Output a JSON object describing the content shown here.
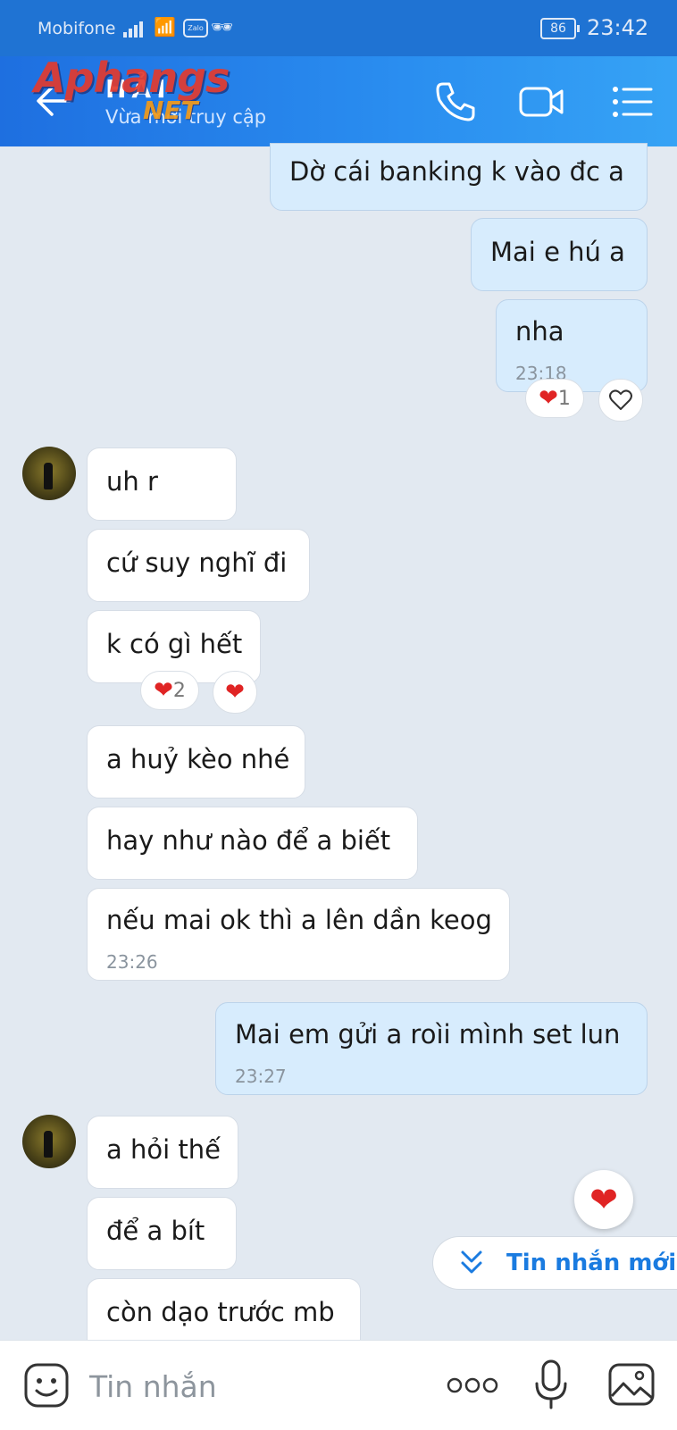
{
  "status_bar": {
    "carrier": "Mobifone",
    "battery": "86",
    "time": "23:42",
    "zalo_badge": "Zalo"
  },
  "header": {
    "watermark_main": "Aphangs",
    "watermark_sub": "NET",
    "contact_name": "HẢI",
    "contact_status": "Vừa mới truy cập",
    "icons": [
      "back-arrow-icon",
      "phone-icon",
      "video-camera-icon",
      "list-menu-icon"
    ]
  },
  "messages": {
    "m1": {
      "text": "Dờ cái banking k vào đc a",
      "side": "sent"
    },
    "m2": {
      "text": "Mai e hú a",
      "side": "sent"
    },
    "m3": {
      "text": "nha",
      "time": "23:18",
      "side": "sent",
      "reaction_count": "1"
    },
    "m4": {
      "text": "uh r",
      "side": "received"
    },
    "m5": {
      "text": "cứ suy nghĩ đi",
      "side": "received"
    },
    "m6": {
      "text": "k có gì hết",
      "side": "received",
      "reaction_count": "2"
    },
    "m7": {
      "text": "a huỷ kèo nhé",
      "side": "received"
    },
    "m8": {
      "text": "hay như nào để a biết",
      "side": "received"
    },
    "m9": {
      "text": "nếu mai ok thì a lên dần keog",
      "time": "23:26",
      "side": "received"
    },
    "m10": {
      "text": "Mai em gửi a roìi mình set lun",
      "time": "23:27",
      "side": "sent"
    },
    "m11": {
      "text": "a hỏi thế",
      "side": "received"
    },
    "m12": {
      "text": "để a bít",
      "side": "received"
    },
    "m13": {
      "text": "còn dạo trước mb",
      "side": "received"
    }
  },
  "new_messages_button": {
    "label": "Tin nhắn mới"
  },
  "input_bar": {
    "placeholder": "Tin nhắn",
    "icons": [
      "sticker-icon",
      "more-dots-icon",
      "microphone-icon",
      "image-icon"
    ]
  },
  "colors": {
    "header": "#2a8ef0",
    "sent_bubble": "#d7ecfd",
    "received_bubble": "#ffffff",
    "heart": "#e02424",
    "background": "#e2e9f1",
    "accent": "#1a7be0"
  }
}
